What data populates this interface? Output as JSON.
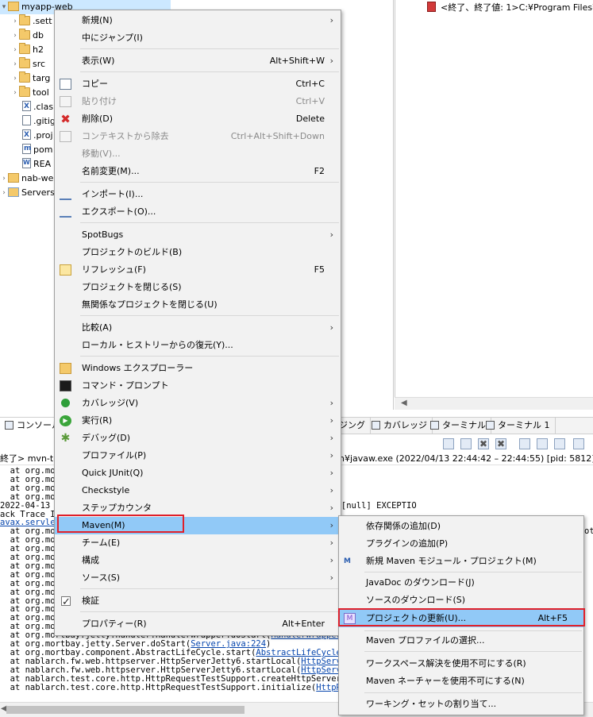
{
  "tree": {
    "project": "myapp-web",
    "items": [
      {
        "label": ".sett",
        "type": "folder"
      },
      {
        "label": "db",
        "type": "folder"
      },
      {
        "label": "h2",
        "type": "folder"
      },
      {
        "label": "src",
        "type": "folder"
      },
      {
        "label": "targ",
        "type": "folder"
      },
      {
        "label": "tool",
        "type": "folder"
      },
      {
        "label": ".clas",
        "type": "file"
      },
      {
        "label": ".gitig",
        "type": "file"
      },
      {
        "label": ".proj",
        "type": "file"
      },
      {
        "label": "pom",
        "type": "file"
      },
      {
        "label": "REA",
        "type": "file"
      }
    ],
    "other_project": "nab-we",
    "servers": "Servers"
  },
  "right_panel": {
    "terminated_text": "<終了、終了値: 1>C:¥Program Files¥"
  },
  "tabs": {
    "console": "コンソール",
    "ging": "ジング",
    "coverage": "カバレッジ",
    "terminal": "ターミナル",
    "terminal1": "ターミナル 1"
  },
  "console": {
    "status_left": "終了> mvn-te",
    "status_right": "n¥javaw.exe  (2022/04/13 22:44:42 – 22:44:55) [pid: 5812]",
    "lines": [
      {
        "pre": "  at org.mo",
        "link": "",
        "post": ""
      },
      {
        "pre": "  at org.mo",
        "gap": "                    ",
        "link": "l.java:708)",
        "post": ""
      },
      {
        "pre": "  at org.mo",
        "gap": "                    ",
        "link": "l.java:582)",
        "post": ""
      },
      {
        "pre": "  at org.mo",
        "link": "",
        "post": ""
      },
      {
        "pre": "2022-04-13 22",
        "gap": "                  ",
        "link": "",
        "post": "sys = [web] req_id = [null] usr_id = [null] EXCEPTIO"
      },
      {
        "pre": "ack Trace I",
        "link": "",
        "post": ""
      },
      {
        "pre": "",
        "link": "avax.servlet",
        "post": "",
        "red": false
      },
      {
        "pre": "  at org.mo",
        "link": "",
        "post": ""
      },
      {
        "pre": "  at org.mo",
        "link": "",
        "post": ""
      },
      {
        "pre": "  at org.mo",
        "link": "",
        "post": ""
      },
      {
        "pre": "  at org.mo",
        "link": "",
        "post": ""
      },
      {
        "pre": "  at org.mo",
        "link": "",
        "post": ""
      },
      {
        "pre": "  at org.mo",
        "link": "",
        "post": ""
      },
      {
        "pre": "  at org.mo",
        "link": "",
        "post": ""
      },
      {
        "pre": "  at org.mo",
        "link": "",
        "post": ""
      },
      {
        "pre": "  at org.mo",
        "link": "",
        "post": ""
      },
      {
        "pre": "  at org.mo",
        "link": "",
        "post": ""
      },
      {
        "pre": "  at org.mo",
        "link": "",
        "post": ""
      },
      {
        "pre": "  at org.mo",
        "link": "",
        "post": ""
      },
      {
        "pre": "  at org.mortbay.jetty.handler.HandlerWrapper.doStart(",
        "link": "HandlerWrapper.j",
        "post": ""
      },
      {
        "pre": "  at org.mortbay.jetty.Server.doStart(",
        "link": "Server.java:224",
        "post": ")"
      },
      {
        "pre": "  at org.mortbay.component.AbstractLifeCycle.start(",
        "link": "AbstractLifeCycle.j",
        "post": ""
      },
      {
        "pre": "  at nablarch.fw.web.httpserver.HttpServerJetty6.startLocal(",
        "link": "HttpServer",
        "post": ""
      },
      {
        "pre": "  at nablarch.fw.web.httpserver.HttpServerJetty6.startLocal(",
        "link": "HttpServer",
        "post": ""
      },
      {
        "pre": "  at nablarch.test.core.http.HttpRequestTestSupport.createHttpServer(",
        "link": "H",
        "post": ""
      },
      {
        "pre": "  at nablarch.test.core.http.HttpRequestTestSupport.initialize(",
        "link": "HttpReq",
        "post": ""
      }
    ],
    "right_fragment": "ot"
  },
  "context_menu": {
    "items": [
      {
        "label": "新規(N)",
        "shortcut": "",
        "arrow": true,
        "disabled": false,
        "icon": ""
      },
      {
        "label": "中にジャンプ(I)",
        "shortcut": "",
        "arrow": false,
        "disabled": false,
        "icon": ""
      },
      {
        "label": "表示(W)",
        "shortcut": "Alt+Shift+W",
        "arrow": true,
        "disabled": false,
        "icon": ""
      },
      {
        "label": "コピー",
        "shortcut": "Ctrl+C",
        "arrow": false,
        "disabled": false,
        "icon": "copy-icon"
      },
      {
        "label": "貼り付け",
        "shortcut": "Ctrl+V",
        "arrow": false,
        "disabled": true,
        "icon": "paste-icon"
      },
      {
        "label": "削除(D)",
        "shortcut": "Delete",
        "arrow": false,
        "disabled": false,
        "icon": "delete-icon"
      },
      {
        "label": "コンテキストから除去",
        "shortcut": "Ctrl+Alt+Shift+Down",
        "arrow": false,
        "disabled": true,
        "icon": "remove-context-icon"
      },
      {
        "label": "移動(V)...",
        "shortcut": "",
        "arrow": false,
        "disabled": true,
        "icon": ""
      },
      {
        "label": "名前変更(M)...",
        "shortcut": "F2",
        "arrow": false,
        "disabled": false,
        "icon": ""
      },
      {
        "label": "インポート(I)...",
        "shortcut": "",
        "arrow": false,
        "disabled": false,
        "icon": "import-icon"
      },
      {
        "label": "エクスポート(O)...",
        "shortcut": "",
        "arrow": false,
        "disabled": false,
        "icon": "export-icon"
      },
      {
        "label": "SpotBugs",
        "shortcut": "",
        "arrow": true,
        "disabled": false,
        "icon": ""
      },
      {
        "label": "プロジェクトのビルド(B)",
        "shortcut": "",
        "arrow": false,
        "disabled": false,
        "icon": ""
      },
      {
        "label": "リフレッシュ(F)",
        "shortcut": "F5",
        "arrow": false,
        "disabled": false,
        "icon": "refresh-icon"
      },
      {
        "label": "プロジェクトを閉じる(S)",
        "shortcut": "",
        "arrow": false,
        "disabled": false,
        "icon": ""
      },
      {
        "label": "無関係なプロジェクトを閉じる(U)",
        "shortcut": "",
        "arrow": false,
        "disabled": false,
        "icon": ""
      },
      {
        "label": "比較(A)",
        "shortcut": "",
        "arrow": true,
        "disabled": false,
        "icon": ""
      },
      {
        "label": "ローカル・ヒストリーからの復元(Y)...",
        "shortcut": "",
        "arrow": false,
        "disabled": false,
        "icon": ""
      },
      {
        "label": "Windows エクスプローラー",
        "shortcut": "",
        "arrow": false,
        "disabled": false,
        "icon": "explorer-icon"
      },
      {
        "label": "コマンド・プロンプト",
        "shortcut": "",
        "arrow": false,
        "disabled": false,
        "icon": "command-prompt-icon"
      },
      {
        "label": "カバレッジ(V)",
        "shortcut": "",
        "arrow": true,
        "disabled": false,
        "icon": "coverage-icon"
      },
      {
        "label": "実行(R)",
        "shortcut": "",
        "arrow": true,
        "disabled": false,
        "icon": "run-icon"
      },
      {
        "label": "デバッグ(D)",
        "shortcut": "",
        "arrow": true,
        "disabled": false,
        "icon": "debug-icon"
      },
      {
        "label": "プロファイル(P)",
        "shortcut": "",
        "arrow": true,
        "disabled": false,
        "icon": ""
      },
      {
        "label": "Quick JUnit(Q)",
        "shortcut": "",
        "arrow": true,
        "disabled": false,
        "icon": ""
      },
      {
        "label": "Checkstyle",
        "shortcut": "",
        "arrow": true,
        "disabled": false,
        "icon": ""
      },
      {
        "label": "ステップカウンタ",
        "shortcut": "",
        "arrow": true,
        "disabled": false,
        "icon": ""
      },
      {
        "label": "Maven(M)",
        "shortcut": "",
        "arrow": true,
        "disabled": false,
        "icon": "",
        "highlighted": true
      },
      {
        "label": "チーム(E)",
        "shortcut": "",
        "arrow": true,
        "disabled": false,
        "icon": ""
      },
      {
        "label": "構成",
        "shortcut": "",
        "arrow": true,
        "disabled": false,
        "icon": ""
      },
      {
        "label": "ソース(S)",
        "shortcut": "",
        "arrow": true,
        "disabled": false,
        "icon": ""
      },
      {
        "label": "検証",
        "shortcut": "",
        "arrow": false,
        "disabled": false,
        "icon": "validate-check-icon"
      },
      {
        "label": "プロパティー(R)",
        "shortcut": "Alt+Enter",
        "arrow": false,
        "disabled": false,
        "icon": ""
      }
    ]
  },
  "maven_submenu": {
    "items": [
      {
        "label": "依存関係の追加(D)",
        "shortcut": "",
        "icon": ""
      },
      {
        "label": "プラグインの追加(P)",
        "shortcut": "",
        "icon": ""
      },
      {
        "label": "新規 Maven モジュール・プロジェクト(M)",
        "shortcut": "",
        "icon": "maven-module-icon"
      },
      {
        "label": "JavaDoc のダウンロード(J)",
        "shortcut": "",
        "icon": ""
      },
      {
        "label": "ソースのダウンロード(S)",
        "shortcut": "",
        "icon": ""
      },
      {
        "label": "プロジェクトの更新(U)...",
        "shortcut": "Alt+F5",
        "icon": "update-project-icon",
        "highlighted": true
      },
      {
        "label": "Maven プロファイルの選択...",
        "shortcut": "",
        "icon": ""
      },
      {
        "label": "ワークスペース解決を使用不可にする(R)",
        "shortcut": "",
        "icon": ""
      },
      {
        "label": "Maven ネーチャーを使用不可にする(N)",
        "shortcut": "",
        "icon": ""
      },
      {
        "label": "ワーキング・セットの割り当て...",
        "shortcut": "",
        "icon": ""
      }
    ]
  },
  "colors": {
    "highlight": "#91c9f7",
    "annotation_red": "#e0202a",
    "link": "#0645ad"
  }
}
